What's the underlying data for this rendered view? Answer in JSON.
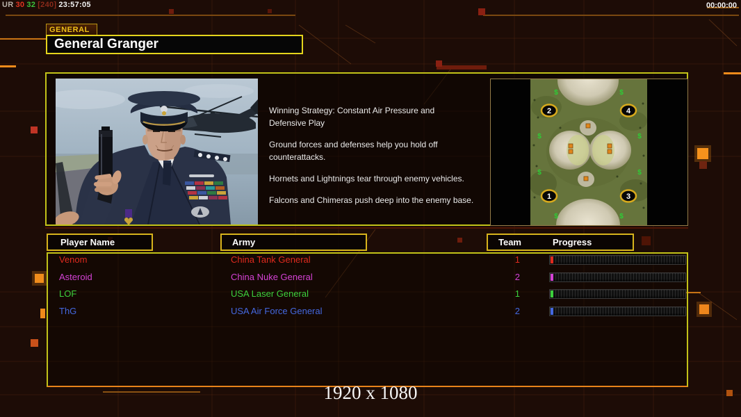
{
  "hud": {
    "debug": {
      "label": "UR",
      "fps": "30",
      "count": "32",
      "bracket": "[240]",
      "time": "23:57:05"
    },
    "match_clock": "00:00:00"
  },
  "general_panel": {
    "tab_label": "GENERAL",
    "name": "General Granger",
    "strategy": [
      "Winning Strategy: Constant Air Pressure and\n Defensive Play",
      "Ground forces and defenses help you hold off\n counterattacks.",
      "Hornets and Lightnings tear through enemy vehicles.",
      "Falcons and Chimeras push deep into the enemy base."
    ]
  },
  "minimap": {
    "start_positions": [
      "2",
      "4",
      "1",
      "3"
    ],
    "supply_symbol": "$"
  },
  "table": {
    "headers": {
      "player_name": "Player Name",
      "army": "Army",
      "team": "Team",
      "progress": "Progress"
    },
    "rows": [
      {
        "name": "Venom",
        "army": "China Tank General",
        "team": "1",
        "color": "#e02a1e"
      },
      {
        "name": "Asteroid",
        "army": "China Nuke General",
        "team": "2",
        "color": "#d442d4"
      },
      {
        "name": "LOF",
        "army": "USA Laser General",
        "team": "1",
        "color": "#3cd03c"
      },
      {
        "name": "ThG",
        "army": "USA Air Force General",
        "team": "2",
        "color": "#4468e0"
      }
    ],
    "progress_fraction": 0.02
  },
  "footer": {
    "resolution_label": "1920 x 1080"
  },
  "colors": {
    "background": "#1d0c06",
    "panel_border_yellow": "#c2c218",
    "header_border_gold": "#d8b41c",
    "accent_orange": "#e8821a",
    "debug_red": "#e23320",
    "debug_green": "#3bc23b",
    "supply_green": "#2ecc36",
    "start_marker_ring": "#d8aa1c"
  }
}
